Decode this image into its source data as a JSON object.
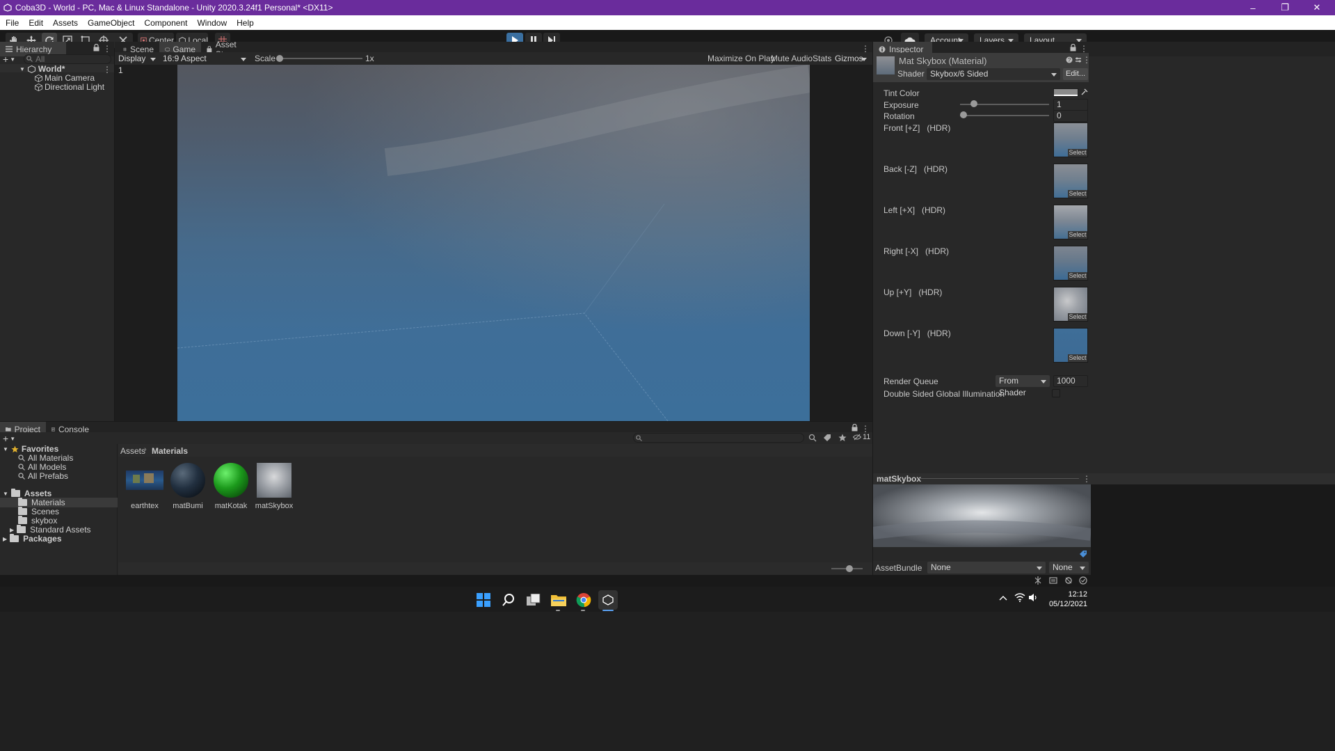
{
  "window": {
    "title": "Coba3D - World - PC, Mac & Linux Standalone - Unity 2020.3.24f1 Personal* <DX11>",
    "controls": [
      "minimize",
      "maximize",
      "close"
    ]
  },
  "menu": [
    "File",
    "Edit",
    "Assets",
    "GameObject",
    "Component",
    "Window",
    "Help"
  ],
  "toolbar": {
    "pivot_label": "Center",
    "space_label": "Local",
    "account_label": "Account",
    "layers_label": "Layers",
    "layout_label": "Layout"
  },
  "hierarchy": {
    "title": "Hierarchy",
    "search_placeholder": "All",
    "scene": "World*",
    "objects": [
      "Main Camera",
      "Directional Light"
    ]
  },
  "game_view": {
    "tabs": [
      "Scene",
      "Game",
      "Asset Store"
    ],
    "active_tab": "Game",
    "display": "Display 1",
    "aspect": "16:9 Aspect",
    "scale_label": "Scale",
    "scale_value": "1x",
    "options": [
      "Maximize On Play",
      "Mute Audio",
      "Stats",
      "Gizmos"
    ]
  },
  "inspector": {
    "title": "Inspector",
    "material_name": "Mat Skybox (Material)",
    "shader_label": "Shader",
    "shader_value": "Skybox/6 Sided",
    "edit_label": "Edit...",
    "tint_label": "Tint Color",
    "exposure_label": "Exposure",
    "exposure_value": "1",
    "rotation_label": "Rotation",
    "rotation_value": "0",
    "faces": [
      {
        "label": "Front [+Z]",
        "hdr": "(HDR)",
        "select": "Select"
      },
      {
        "label": "Back [-Z]",
        "hdr": "(HDR)",
        "select": "Select"
      },
      {
        "label": "Left [+X]",
        "hdr": "(HDR)",
        "select": "Select"
      },
      {
        "label": "Right [-X]",
        "hdr": "(HDR)",
        "select": "Select"
      },
      {
        "label": "Up [+Y]",
        "hdr": "(HDR)",
        "select": "Select"
      },
      {
        "label": "Down [-Y]",
        "hdr": "(HDR)",
        "select": "Select"
      }
    ],
    "render_queue_label": "Render Queue",
    "render_queue_mode": "From Shader",
    "render_queue_value": "1000",
    "double_sided_label": "Double Sided Global Illumination",
    "preview_title": "matSkybox",
    "assetbundle_label": "AssetBundle",
    "assetbundle_value": "None",
    "assetbundle_variant": "None"
  },
  "project": {
    "tabs": [
      "Project",
      "Console"
    ],
    "hidden_count": "11",
    "favorites_label": "Favorites",
    "favorites": [
      "All Materials",
      "All Models",
      "All Prefabs"
    ],
    "assets_label": "Assets",
    "folders": [
      "Materials",
      "Scenes",
      "skybox",
      "Standard Assets"
    ],
    "packages_label": "Packages",
    "breadcrumb": [
      "Assets",
      "Materials"
    ],
    "items": [
      "earthtex",
      "matBumi",
      "matKotak",
      "matSkybox"
    ]
  },
  "taskbar": {
    "time": "12:12",
    "date": "05/12/2021"
  }
}
